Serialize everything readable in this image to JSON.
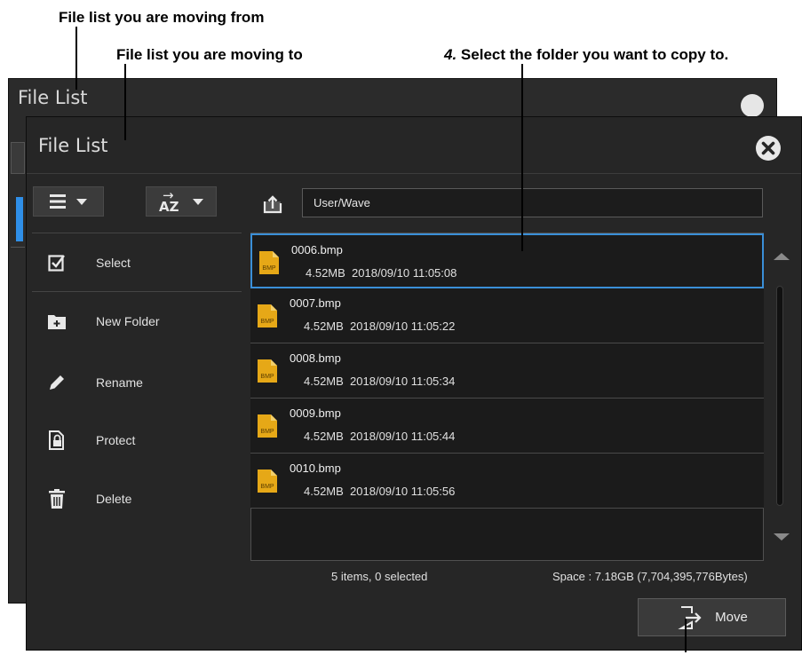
{
  "annotations": {
    "from_label": "File list you are moving from",
    "to_label": "File list you are moving to",
    "step_number": "4.",
    "step_text": "Select the folder you want to copy to."
  },
  "back_dialog": {
    "title": "File List"
  },
  "dialog": {
    "title": "File List",
    "path": "User/Wave",
    "sort_label": "AZ",
    "sort_arrow": "→"
  },
  "sidebar": {
    "items": [
      {
        "label": "Select",
        "icon": "select-check-icon"
      },
      {
        "label": "New Folder",
        "icon": "new-folder-icon"
      },
      {
        "label": "Rename",
        "icon": "pencil-icon"
      },
      {
        "label": "Protect",
        "icon": "lock-file-icon"
      },
      {
        "label": "Delete",
        "icon": "trash-icon"
      }
    ]
  },
  "files": [
    {
      "name": "0006.bmp",
      "size": "4.52MB",
      "date": "2018/09/10 11:05:08",
      "selected": true
    },
    {
      "name": "0007.bmp",
      "size": "4.52MB",
      "date": "2018/09/10 11:05:22",
      "selected": false
    },
    {
      "name": "0008.bmp",
      "size": "4.52MB",
      "date": "2018/09/10 11:05:34",
      "selected": false
    },
    {
      "name": "0009.bmp",
      "size": "4.52MB",
      "date": "2018/09/10 11:05:44",
      "selected": false
    },
    {
      "name": "0010.bmp",
      "size": "4.52MB",
      "date": "2018/09/10 11:05:56",
      "selected": false
    }
  ],
  "file_icon_text": "BMP",
  "status": {
    "items": "5 items, 0 selected",
    "space": "Space : 7.18GB (7,704,395,776Bytes)"
  },
  "buttons": {
    "move": "Move"
  },
  "colors": {
    "accent": "#3a8fd8",
    "bmp_icon": "#e6a817",
    "background": "#262626"
  }
}
